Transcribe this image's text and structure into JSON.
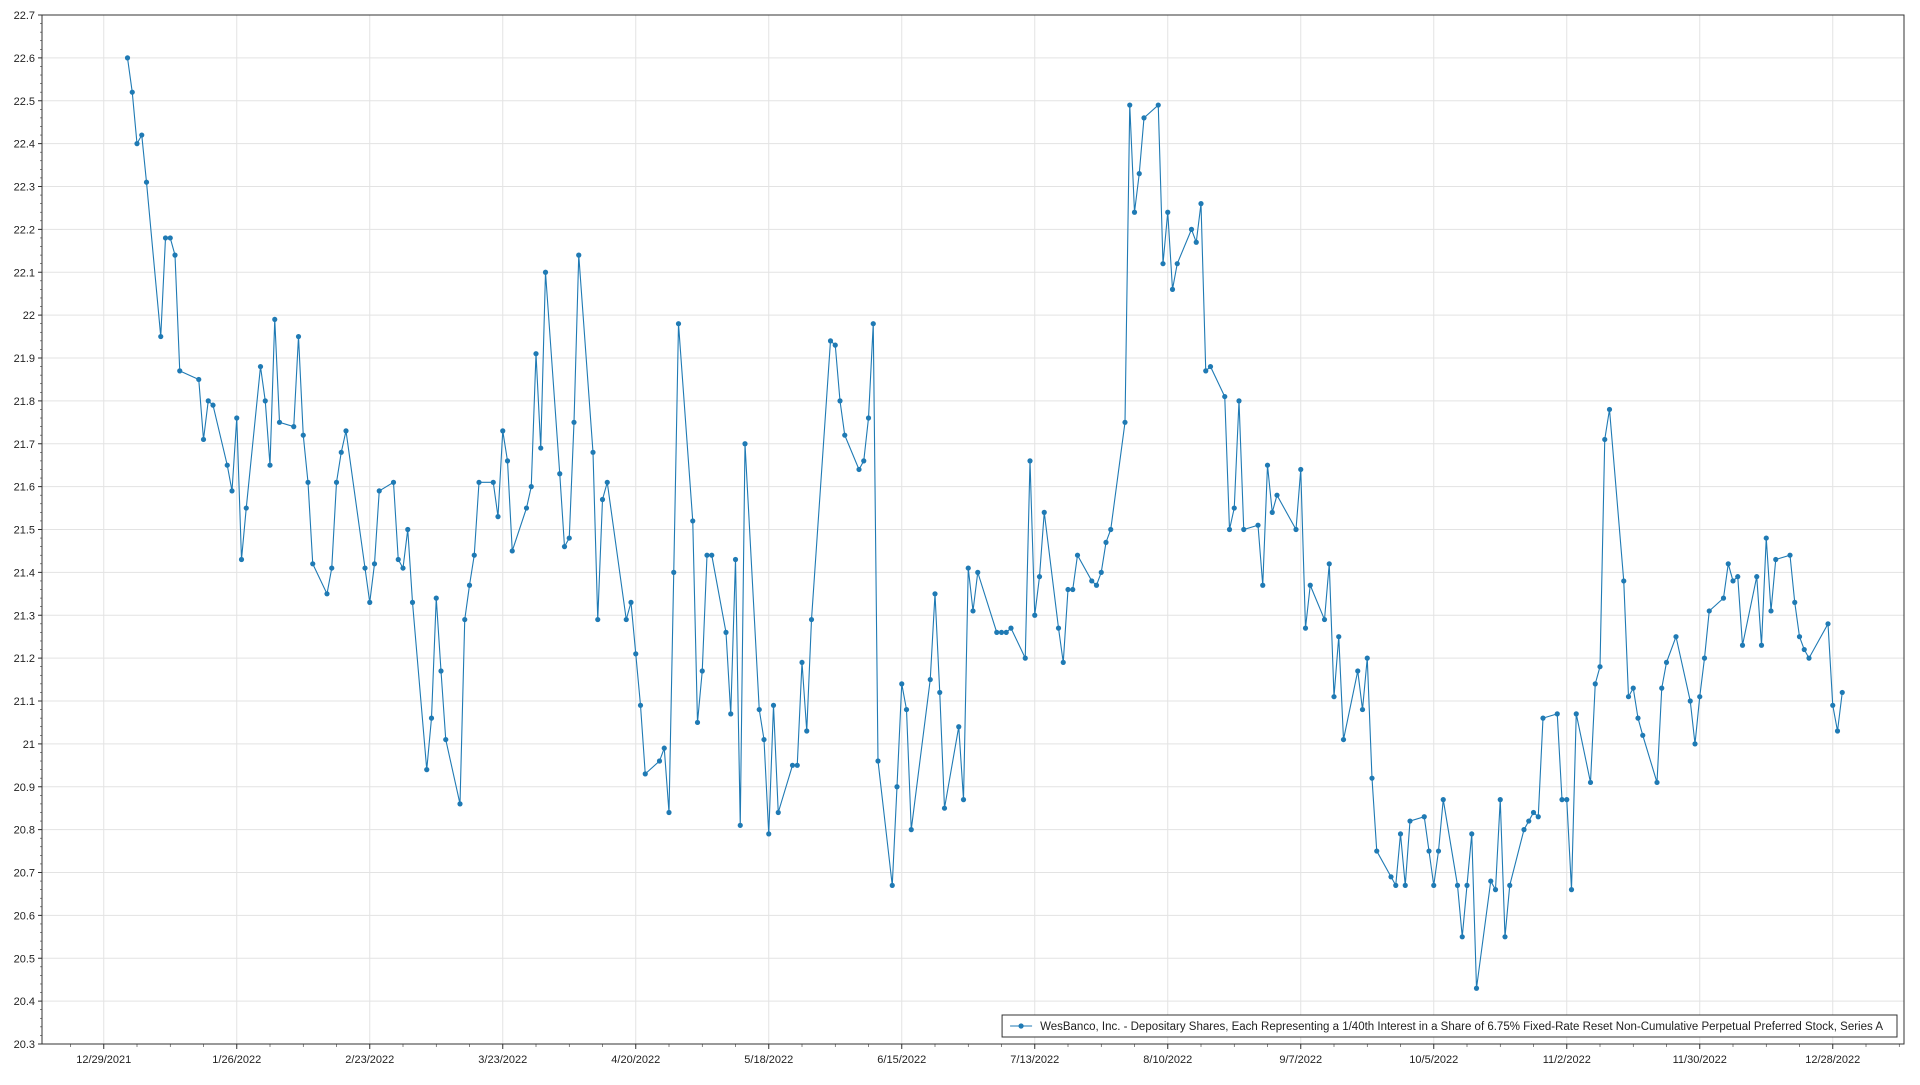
{
  "chart_data": {
    "type": "line",
    "title": "",
    "xlabel": "",
    "ylabel": "",
    "ylim": [
      20.3,
      22.7
    ],
    "y_ticks": [
      20.3,
      20.4,
      20.5,
      20.6,
      20.7,
      20.8,
      20.9,
      21.0,
      21.1,
      21.2,
      21.3,
      21.4,
      21.5,
      21.6,
      21.7,
      21.8,
      21.9,
      22.0,
      22.1,
      22.2,
      22.3,
      22.4,
      22.5,
      22.6,
      22.7
    ],
    "y_tick_labels": [
      "20.3",
      "20.4",
      "20.5",
      "20.6",
      "20.7",
      "20.8",
      "20.9",
      "21",
      "21.1",
      "21.2",
      "21.3",
      "21.4",
      "21.5",
      "21.6",
      "21.7",
      "21.8",
      "21.9",
      "22",
      "22.1",
      "22.2",
      "22.3",
      "22.4",
      "22.5",
      "22.6",
      "22.7"
    ],
    "x_ticks": [
      "2021-12-29",
      "2022-01-26",
      "2022-02-23",
      "2022-03-23",
      "2022-04-20",
      "2022-05-18",
      "2022-06-15",
      "2022-07-13",
      "2022-08-10",
      "2022-09-07",
      "2022-10-05",
      "2022-11-02",
      "2022-11-30",
      "2022-12-28"
    ],
    "x_tick_labels": [
      "12/29/2021",
      "1/26/2022",
      "2/23/2022",
      "3/23/2022",
      "4/20/2022",
      "5/18/2022",
      "6/15/2022",
      "7/13/2022",
      "8/10/2022",
      "9/7/2022",
      "10/5/2022",
      "11/2/2022",
      "11/30/2022",
      "12/28/2022"
    ],
    "xlim": [
      "2021-12-16",
      "2023-01-12"
    ],
    "grid": true,
    "legend_position": "bottom-right",
    "colors": {
      "series": "#1f7ab4",
      "grid": "#e3e3e3",
      "axis": "#333333",
      "frame": "#333333"
    },
    "series": [
      {
        "name": "WesBanco, Inc. - Depositary Shares, Each Representing a 1/40th Interest in a Share of 6.75% Fixed-Rate Reset Non-Cumulative Perpetual Preferred Stock, Series A",
        "x": [
          "2022-01-03",
          "2022-01-04",
          "2022-01-05",
          "2022-01-06",
          "2022-01-07",
          "2022-01-10",
          "2022-01-11",
          "2022-01-12",
          "2022-01-13",
          "2022-01-14",
          "2022-01-18",
          "2022-01-19",
          "2022-01-20",
          "2022-01-21",
          "2022-01-24",
          "2022-01-25",
          "2022-01-26",
          "2022-01-27",
          "2022-01-28",
          "2022-01-31",
          "2022-02-01",
          "2022-02-02",
          "2022-02-03",
          "2022-02-04",
          "2022-02-07",
          "2022-02-08",
          "2022-02-09",
          "2022-02-10",
          "2022-02-11",
          "2022-02-14",
          "2022-02-15",
          "2022-02-16",
          "2022-02-17",
          "2022-02-18",
          "2022-02-22",
          "2022-02-23",
          "2022-02-24",
          "2022-02-25",
          "2022-02-28",
          "2022-03-01",
          "2022-03-02",
          "2022-03-03",
          "2022-03-04",
          "2022-03-07",
          "2022-03-08",
          "2022-03-09",
          "2022-03-10",
          "2022-03-11",
          "2022-03-14",
          "2022-03-15",
          "2022-03-16",
          "2022-03-17",
          "2022-03-18",
          "2022-03-21",
          "2022-03-22",
          "2022-03-23",
          "2022-03-24",
          "2022-03-25",
          "2022-03-28",
          "2022-03-29",
          "2022-03-30",
          "2022-03-31",
          "2022-04-01",
          "2022-04-04",
          "2022-04-05",
          "2022-04-06",
          "2022-04-07",
          "2022-04-08",
          "2022-04-11",
          "2022-04-12",
          "2022-04-13",
          "2022-04-14",
          "2022-04-18",
          "2022-04-19",
          "2022-04-20",
          "2022-04-21",
          "2022-04-22",
          "2022-04-25",
          "2022-04-26",
          "2022-04-27",
          "2022-04-28",
          "2022-04-29",
          "2022-05-02",
          "2022-05-03",
          "2022-05-04",
          "2022-05-05",
          "2022-05-06",
          "2022-05-09",
          "2022-05-10",
          "2022-05-11",
          "2022-05-12",
          "2022-05-13",
          "2022-05-16",
          "2022-05-17",
          "2022-05-18",
          "2022-05-19",
          "2022-05-20",
          "2022-05-23",
          "2022-05-24",
          "2022-05-25",
          "2022-05-26",
          "2022-05-27",
          "2022-05-31",
          "2022-06-01",
          "2022-06-02",
          "2022-06-03",
          "2022-06-06",
          "2022-06-07",
          "2022-06-08",
          "2022-06-09",
          "2022-06-10",
          "2022-06-13",
          "2022-06-14",
          "2022-06-15",
          "2022-06-16",
          "2022-06-17",
          "2022-06-21",
          "2022-06-22",
          "2022-06-23",
          "2022-06-24",
          "2022-06-27",
          "2022-06-28",
          "2022-06-29",
          "2022-06-30",
          "2022-07-01",
          "2022-07-05",
          "2022-07-06",
          "2022-07-07",
          "2022-07-08",
          "2022-07-11",
          "2022-07-12",
          "2022-07-13",
          "2022-07-14",
          "2022-07-15",
          "2022-07-18",
          "2022-07-19",
          "2022-07-20",
          "2022-07-21",
          "2022-07-22",
          "2022-07-25",
          "2022-07-26",
          "2022-07-27",
          "2022-07-28",
          "2022-07-29",
          "2022-08-01",
          "2022-08-02",
          "2022-08-03",
          "2022-08-04",
          "2022-08-05",
          "2022-08-08",
          "2022-08-09",
          "2022-08-10",
          "2022-08-11",
          "2022-08-12",
          "2022-08-15",
          "2022-08-16",
          "2022-08-17",
          "2022-08-18",
          "2022-08-19",
          "2022-08-22",
          "2022-08-23",
          "2022-08-24",
          "2022-08-25",
          "2022-08-26",
          "2022-08-29",
          "2022-08-30",
          "2022-08-31",
          "2022-09-01",
          "2022-09-02",
          "2022-09-06",
          "2022-09-07",
          "2022-09-08",
          "2022-09-09",
          "2022-09-12",
          "2022-09-13",
          "2022-09-14",
          "2022-09-15",
          "2022-09-16",
          "2022-09-19",
          "2022-09-20",
          "2022-09-21",
          "2022-09-22",
          "2022-09-23",
          "2022-09-26",
          "2022-09-27",
          "2022-09-28",
          "2022-09-29",
          "2022-09-30",
          "2022-10-03",
          "2022-10-04",
          "2022-10-05",
          "2022-10-06",
          "2022-10-07",
          "2022-10-10",
          "2022-10-11",
          "2022-10-12",
          "2022-10-13",
          "2022-10-14",
          "2022-10-17",
          "2022-10-18",
          "2022-10-19",
          "2022-10-20",
          "2022-10-21",
          "2022-10-24",
          "2022-10-25",
          "2022-10-26",
          "2022-10-27",
          "2022-10-28",
          "2022-10-31",
          "2022-11-01",
          "2022-11-02",
          "2022-11-03",
          "2022-11-04",
          "2022-11-07",
          "2022-11-08",
          "2022-11-09",
          "2022-11-10",
          "2022-11-11",
          "2022-11-14",
          "2022-11-15",
          "2022-11-16",
          "2022-11-17",
          "2022-11-18",
          "2022-11-21",
          "2022-11-22",
          "2022-11-23",
          "2022-11-25",
          "2022-11-28",
          "2022-11-29",
          "2022-11-30",
          "2022-12-01",
          "2022-12-02",
          "2022-12-05",
          "2022-12-06",
          "2022-12-07",
          "2022-12-08",
          "2022-12-09",
          "2022-12-12",
          "2022-12-13",
          "2022-12-14",
          "2022-12-15",
          "2022-12-16",
          "2022-12-19",
          "2022-12-20",
          "2022-12-21",
          "2022-12-22",
          "2022-12-23",
          "2022-12-27",
          "2022-12-28",
          "2022-12-29",
          "2022-12-30"
        ],
        "values": [
          22.6,
          22.52,
          22.4,
          22.42,
          22.31,
          21.95,
          22.18,
          22.18,
          22.14,
          21.87,
          21.85,
          21.71,
          21.8,
          21.79,
          21.65,
          21.59,
          21.76,
          21.43,
          21.55,
          21.88,
          21.8,
          21.65,
          21.99,
          21.75,
          21.74,
          21.95,
          21.72,
          21.61,
          21.42,
          21.35,
          21.41,
          21.61,
          21.68,
          21.73,
          21.41,
          21.33,
          21.42,
          21.59,
          21.61,
          21.43,
          21.41,
          21.5,
          21.33,
          20.94,
          21.06,
          21.34,
          21.17,
          21.01,
          20.86,
          21.29,
          21.37,
          21.44,
          21.61,
          21.61,
          21.53,
          21.73,
          21.66,
          21.45,
          21.55,
          21.6,
          21.91,
          21.69,
          22.1,
          21.63,
          21.46,
          21.48,
          21.75,
          22.14,
          21.68,
          21.29,
          21.57,
          21.61,
          21.29,
          21.33,
          21.21,
          21.09,
          20.93,
          20.96,
          20.99,
          20.84,
          21.4,
          21.98,
          21.52,
          21.05,
          21.17,
          21.44,
          21.44,
          21.26,
          21.07,
          21.43,
          20.81,
          21.7,
          21.08,
          21.01,
          20.79,
          21.09,
          20.84,
          20.95,
          20.95,
          21.19,
          21.03,
          21.29,
          21.94,
          21.93,
          21.8,
          21.72,
          21.64,
          21.66,
          21.76,
          21.98,
          20.96,
          20.67,
          20.9,
          21.14,
          21.08,
          20.8,
          21.15,
          21.35,
          21.12,
          20.85,
          21.04,
          20.87,
          21.41,
          21.31,
          21.4,
          21.26,
          21.26,
          21.26,
          21.27,
          21.2,
          21.66,
          21.3,
          21.39,
          21.54,
          21.27,
          21.19,
          21.36,
          21.36,
          21.44,
          21.38,
          21.37,
          21.4,
          21.47,
          21.5,
          21.75,
          22.49,
          22.24,
          22.33,
          22.46,
          22.49,
          22.12,
          22.24,
          22.06,
          22.12,
          22.2,
          22.17,
          22.26,
          21.87,
          21.88,
          21.81,
          21.5,
          21.55,
          21.8,
          21.5,
          21.51,
          21.37,
          21.65,
          21.54,
          21.58,
          21.5,
          21.64,
          21.27,
          21.37,
          21.29,
          21.42,
          21.11,
          21.25,
          21.01,
          21.17,
          21.08,
          21.2,
          20.92,
          20.75,
          20.69,
          20.67,
          20.79,
          20.67,
          20.82,
          20.83,
          20.75,
          20.67,
          20.75,
          20.87,
          20.67,
          20.55,
          20.67,
          20.79,
          20.43,
          20.68,
          20.66,
          20.87,
          20.55,
          20.67,
          20.8,
          20.82,
          20.84,
          20.83,
          21.06,
          21.07,
          20.87,
          20.87,
          20.66,
          21.07,
          20.91,
          21.14,
          21.18,
          21.71,
          21.78,
          21.38,
          21.11,
          21.13,
          21.06,
          21.02,
          20.91,
          21.13,
          21.19,
          21.25,
          21.1,
          21.0,
          21.11,
          21.2,
          21.31,
          21.34,
          21.42,
          21.38,
          21.39,
          21.23,
          21.39,
          21.23,
          21.48,
          21.31,
          21.43,
          21.44,
          21.33,
          21.25,
          21.22,
          21.2,
          21.28,
          21.09,
          21.03,
          21.12
        ]
      }
    ]
  }
}
